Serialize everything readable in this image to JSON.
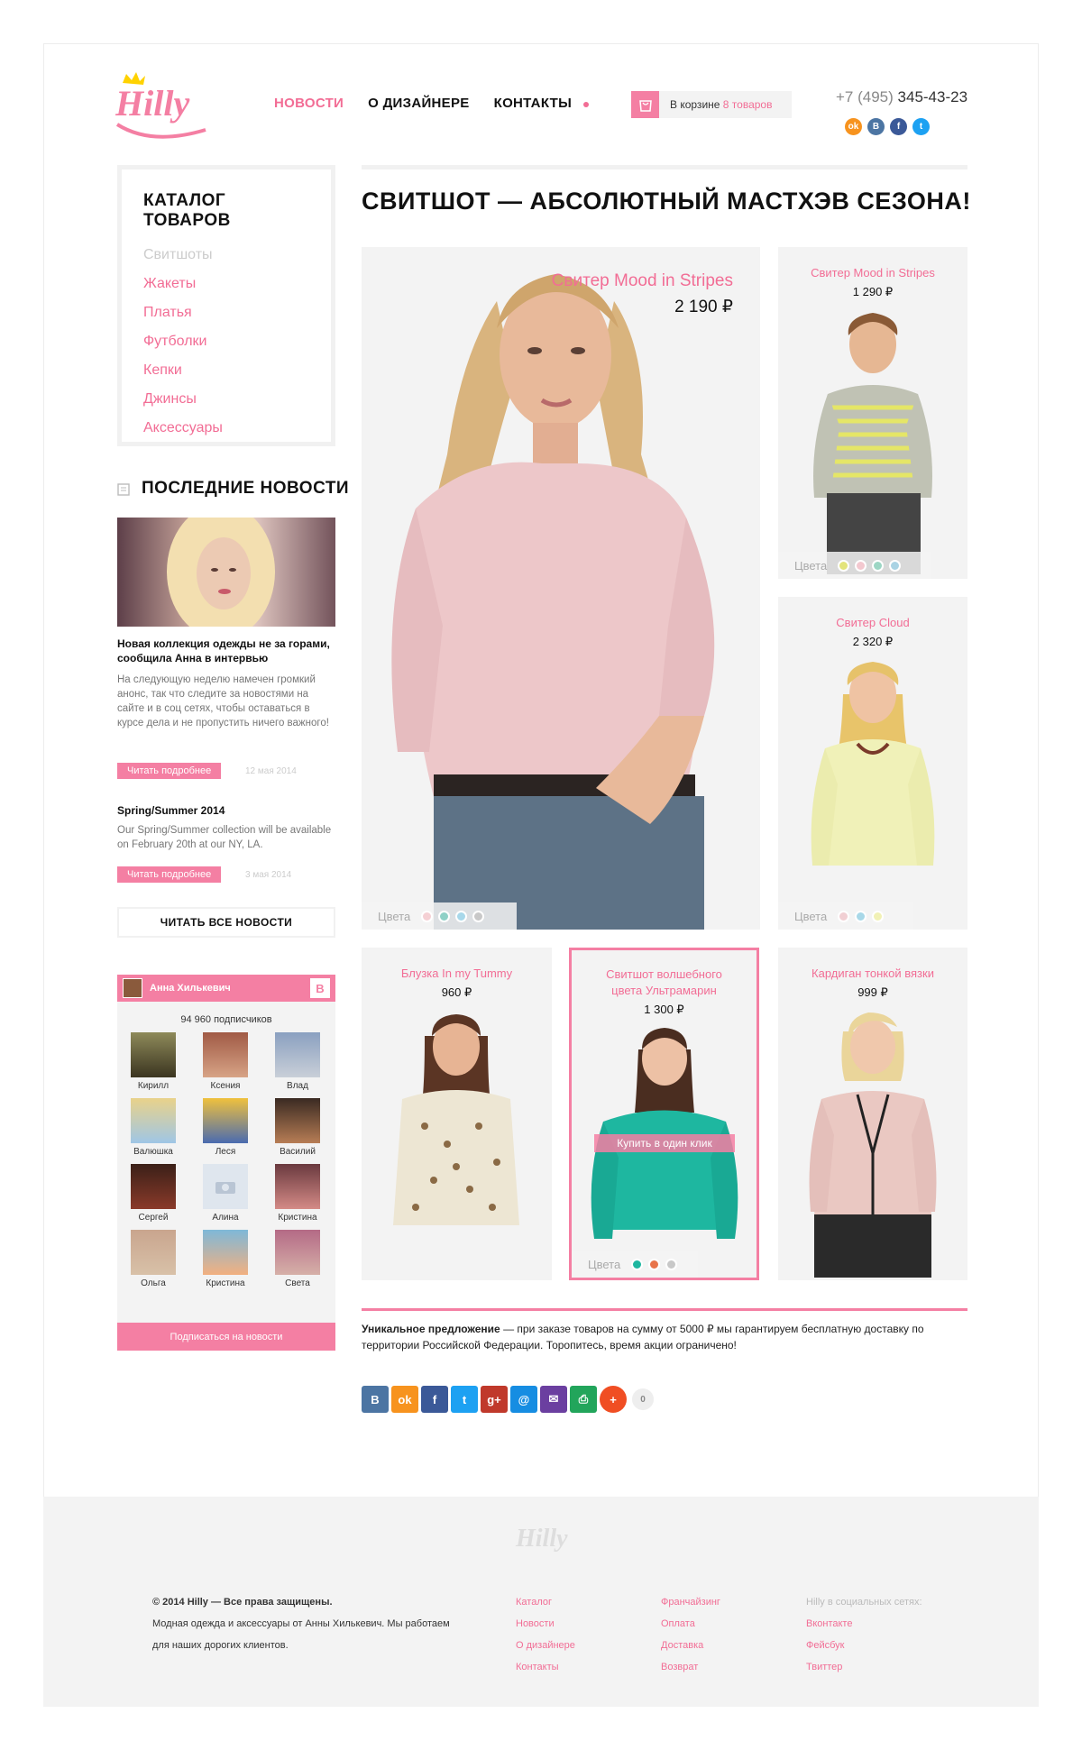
{
  "header": {
    "logo_text": "Hilly",
    "nav": [
      "НОВОСТИ",
      "О ДИЗАЙНЕРЕ",
      "КОНТАКТЫ"
    ],
    "cart_prefix": "В корзине",
    "cart_count": "8 товаров",
    "phone_code": "+7 (495)",
    "phone_number": "345-43-23",
    "social_icons": [
      "odnoklassniki-icon",
      "vk-icon",
      "facebook-icon",
      "twitter-icon"
    ]
  },
  "catalog": {
    "title": "КАТАЛОГ ТОВАРОВ",
    "items": [
      "Свитшоты",
      "Жакеты",
      "Платья",
      "Футболки",
      "Кепки",
      "Джинсы",
      "Аксессуары"
    ]
  },
  "news": {
    "title": "ПОСЛЕДНИЕ НОВОСТИ",
    "items": [
      {
        "title": "Новая коллекция одежды не за горами, сообщила Анна в интервью",
        "text": "На следующую неделю намечен громкий анонс, так что следите за новостями на сайте и в соц сетях, чтобы оставаться в курсе дела и не пропустить ничего важного!",
        "button": "Читать подробнее",
        "date": "12 мая 2014"
      },
      {
        "title": "Spring/Summer 2014",
        "text": "Our Spring/Summer collection will be available on February 20th at our NY, LA.",
        "button": "Читать подробнее",
        "date": "3 мая 2014"
      }
    ],
    "all_button": "ЧИТАТЬ ВСЕ НОВОСТИ"
  },
  "vk_widget": {
    "name": "Анна Хилькевич",
    "badge": "В",
    "subscribers": "94 960 подписчиков",
    "members": [
      "Кирилл",
      "Ксения",
      "Влад",
      "Валюшка",
      "Леся",
      "Василий",
      "Сергей",
      "Алина",
      "Кристина",
      "Ольга",
      "Кристина",
      "Света"
    ],
    "subscribe_button": "Подписаться на новости"
  },
  "main": {
    "title": "СВИТШОТ — АБСОЛЮТНЫЙ МАСТХЭВ СЕЗОНА!",
    "colors_label": "Цвета",
    "products": [
      {
        "title": "Свитер Mood in Stripes",
        "price": "2 190 ₽"
      },
      {
        "title": "Свитер Mood in Stripes",
        "price": "1 290 ₽"
      },
      {
        "title": "Свитер Cloud",
        "price": "2 320 ₽"
      },
      {
        "title": "Блузка In my Tummy",
        "price": "960 ₽"
      },
      {
        "title": "Свитшот волшебного цвета Ультрамарин",
        "price": "1 300 ₽"
      },
      {
        "title": "Кардиган тонкой вязки",
        "price": "999 ₽"
      }
    ],
    "buy_one_click": "Купить в один клик",
    "unique_bold": "Уникальное предложение",
    "unique_text": " — при заказе товаров на сумму от 5000 ₽ мы гарантируем бесплатную доставку по территории Российской Федерации. Торопитесь, время акции ограничено!",
    "share_icons": [
      "В",
      "ok",
      "f",
      "t",
      "g+",
      "@",
      "✉",
      "⎙",
      "+"
    ],
    "share_count": "0"
  },
  "footer": {
    "logo": "Hilly",
    "copyright": "© 2014 Hilly — Все права защищены.",
    "about": "Модная одежда и аксессуары от Анны Хилькевич. Мы работаем для наших дорогих клиентов.",
    "col1": [
      "Каталог",
      "Новости",
      "О дизайнере",
      "Контакты"
    ],
    "col2": [
      "Франчайзинг",
      "Оплата",
      "Доставка",
      "Возврат"
    ],
    "social_title": "Hilly в социальных сетях:",
    "col3": [
      "Вконтакте",
      "Фейсбук",
      "Твиттер"
    ]
  },
  "colors": {
    "accent": "#f47fa3",
    "accent_text": "#f26d95",
    "panel": "#f3f3f3"
  }
}
